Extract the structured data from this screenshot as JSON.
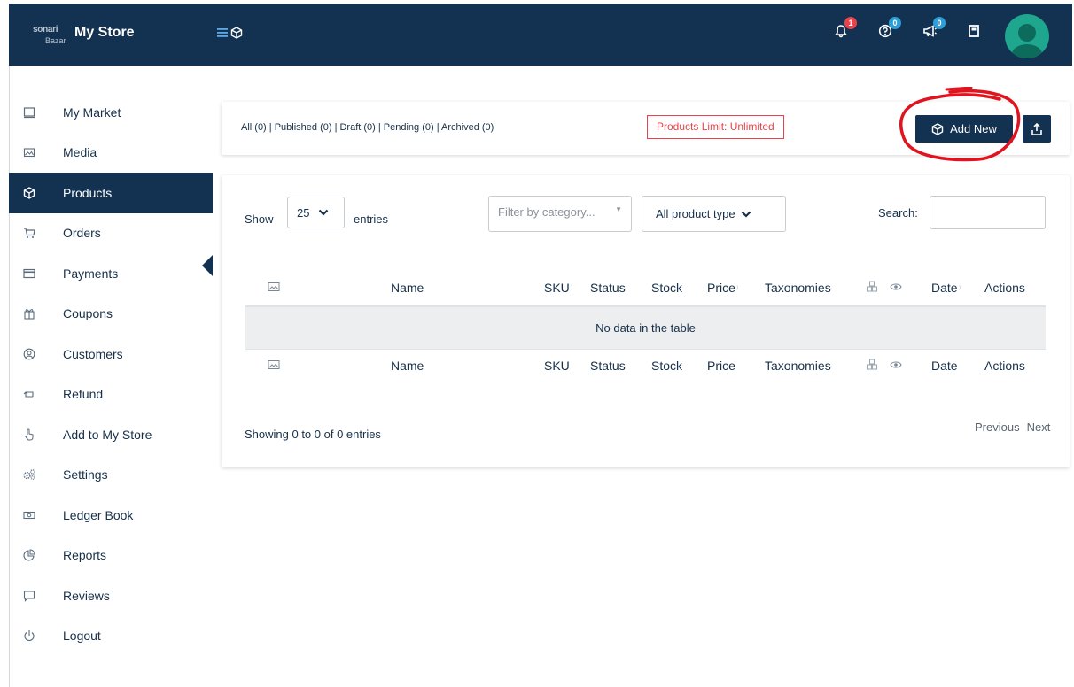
{
  "header": {
    "brand_logo_text_1": "sonari",
    "brand_logo_text_2": "Bazar",
    "title": "My Store",
    "badges": {
      "notifications": "1",
      "help": "0",
      "announcements": "0"
    }
  },
  "sidebar": {
    "items": [
      {
        "label": "My Market",
        "icon": "monitor-icon"
      },
      {
        "label": "Media",
        "icon": "image-icon"
      },
      {
        "label": "Products",
        "icon": "cube-icon",
        "active": true
      },
      {
        "label": "Orders",
        "icon": "cart-icon"
      },
      {
        "label": "Payments",
        "icon": "credit-card-icon"
      },
      {
        "label": "Coupons",
        "icon": "gift-icon"
      },
      {
        "label": "Customers",
        "icon": "user-circle-icon"
      },
      {
        "label": "Refund",
        "icon": "refund-icon"
      },
      {
        "label": "Add to My Store",
        "icon": "hand-pointer-icon"
      },
      {
        "label": "Settings",
        "icon": "cogs-icon"
      },
      {
        "label": "Ledger Book",
        "icon": "money-icon"
      },
      {
        "label": "Reports",
        "icon": "pie-chart-icon"
      },
      {
        "label": "Reviews",
        "icon": "comment-icon"
      },
      {
        "label": "Logout",
        "icon": "power-icon"
      }
    ]
  },
  "status_bar": {
    "links": "All (0) | Published (0) | Draft (0) | Pending (0) | Archived (0)",
    "limit": "Products Limit: Unlimited",
    "add_new": "Add New"
  },
  "controls": {
    "show": "Show",
    "entries_value": "25",
    "entries": "entries",
    "category_placeholder": "Filter by category...",
    "product_type": "All product type",
    "search_label": "Search:"
  },
  "table": {
    "columns": [
      "Name",
      "SKU",
      "Status",
      "Stock",
      "Price",
      "Taxonomies",
      "Date",
      "Actions"
    ],
    "empty": "No data in the table"
  },
  "footer": {
    "info": "Showing 0 to 0 of 0 entries",
    "previous": "Previous",
    "next": "Next"
  },
  "colors": {
    "primary": "#133150",
    "danger": "#e8434c",
    "accent": "#2e9fd6",
    "annotation": "#e0141e"
  }
}
